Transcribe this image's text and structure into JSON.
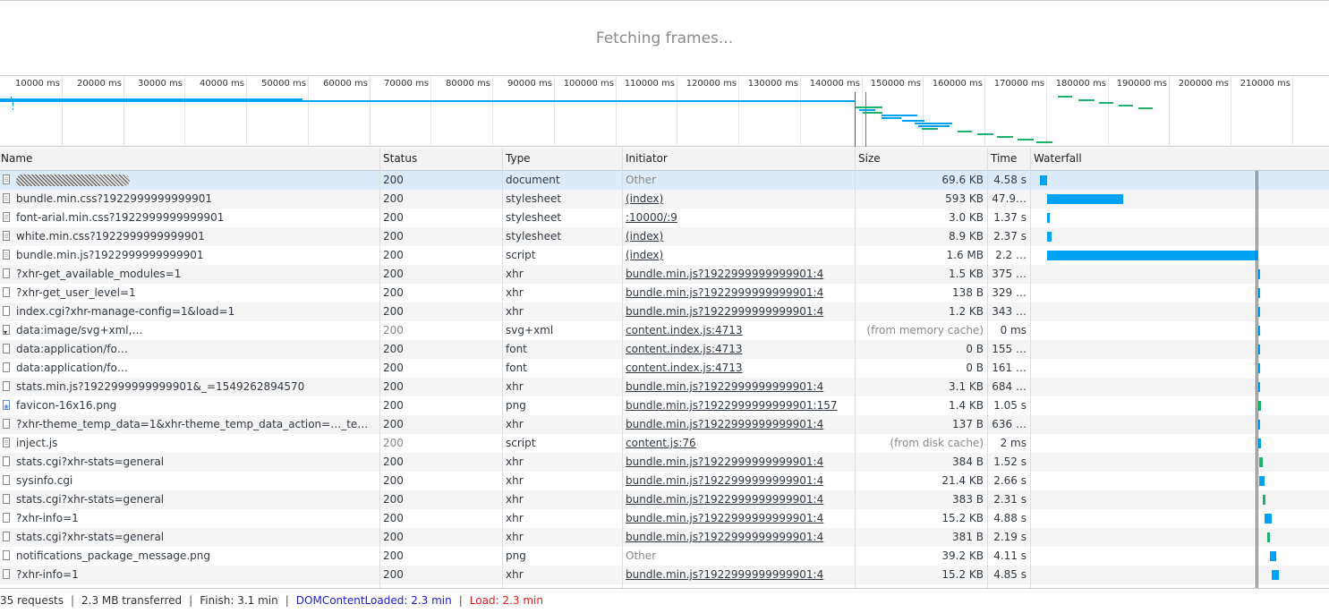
{
  "frames": {
    "message": "Fetching frames..."
  },
  "overview": {
    "max_ms": 216000,
    "ticks": [
      "10000 ms",
      "20000 ms",
      "30000 ms",
      "40000 ms",
      "50000 ms",
      "60000 ms",
      "70000 ms",
      "80000 ms",
      "90000 ms",
      "100000 ms",
      "110000 ms",
      "120000 ms",
      "130000 ms",
      "140000 ms",
      "150000 ms",
      "160000 ms",
      "170000 ms",
      "180000 ms",
      "190000 ms",
      "200000 ms",
      "210000 ms"
    ],
    "dom_content_loaded_ms": 138000,
    "load_ms": 138000
  },
  "columns": {
    "name": "Name",
    "status": "Status",
    "type": "Type",
    "initiator": "Initiator",
    "size": "Size",
    "time": "Time",
    "waterfall": "Waterfall"
  },
  "colors": {
    "bar_blue": "#00a3f3",
    "bar_green": "#1bb36b",
    "dcl_line": "#3b4fd9",
    "load_line": "#e34343",
    "selected_row": "#dcebfa"
  },
  "requests": [
    {
      "name": "",
      "redacted": true,
      "status": "200",
      "type": "document",
      "initiator": "Other",
      "initiator_link": false,
      "size": "69.6 KB",
      "time": "4.58 s",
      "icon": "doc",
      "selected": true,
      "wf_start": 0.002,
      "wf_dur": 0.005,
      "wf_color": "blue"
    },
    {
      "name": "bundle.min.css?1922999999999901",
      "status": "200",
      "type": "stylesheet",
      "initiator": "(index)",
      "initiator_link": true,
      "size": "593 KB",
      "time": "47.9…",
      "icon": "doc",
      "wf_start": 0.007,
      "wf_dur": 0.053,
      "wf_color": "blue"
    },
    {
      "name": "font-arial.min.css?1922999999999901",
      "status": "200",
      "type": "stylesheet",
      "initiator": ":10000/:9",
      "initiator_link": true,
      "size": "3.0 KB",
      "time": "1.37 s",
      "icon": "doc",
      "wf_start": 0.007,
      "wf_dur": 0.002,
      "wf_color": "blue"
    },
    {
      "name": "white.min.css?1922999999999901",
      "status": "200",
      "type": "stylesheet",
      "initiator": "(index)",
      "initiator_link": true,
      "size": "8.9 KB",
      "time": "2.37 s",
      "icon": "doc",
      "wf_start": 0.007,
      "wf_dur": 0.003,
      "wf_color": "blue"
    },
    {
      "name": "bundle.min.js?1922999999999901",
      "status": "200",
      "type": "script",
      "initiator": "(index)",
      "initiator_link": true,
      "size": "1.6 MB",
      "time": "2.2 …",
      "icon": "doc",
      "wf_start": 0.007,
      "wf_dur": 0.147,
      "wf_color": "blue"
    },
    {
      "name": "?xhr-get_available_modules=1",
      "status": "200",
      "type": "xhr",
      "initiator": "bundle.min.js?1922999999999901:4",
      "initiator_link": true,
      "size": "1.5 KB",
      "time": "375 …",
      "icon": "blank",
      "wf_start": 0.1535,
      "wf_dur": 0.0008,
      "wf_color": "blue"
    },
    {
      "name": "?xhr-get_user_level=1",
      "status": "200",
      "type": "xhr",
      "initiator": "bundle.min.js?1922999999999901:4",
      "initiator_link": true,
      "size": "138 B",
      "time": "329 …",
      "icon": "blank",
      "wf_start": 0.1535,
      "wf_dur": 0.0008,
      "wf_color": "blue"
    },
    {
      "name": "index.cgi?xhr-manage-config=1&load=1",
      "status": "200",
      "type": "xhr",
      "initiator": "bundle.min.js?1922999999999901:4",
      "initiator_link": true,
      "size": "1.2 KB",
      "time": "343 …",
      "icon": "blank",
      "wf_start": 0.1535,
      "wf_dur": 0.0008,
      "wf_color": "blue"
    },
    {
      "name": "data:image/svg+xml,…",
      "status": "200",
      "status_gray": true,
      "type": "svg+xml",
      "initiator": "content.index.js:4713",
      "initiator_link": true,
      "size": "(from memory cache)",
      "size_gray": true,
      "time": "0 ms",
      "icon": "svg",
      "wf_start": 0.1535,
      "wf_dur": 0.0006,
      "wf_color": "blue"
    },
    {
      "name": "data:application/fo…",
      "status": "200",
      "type": "font",
      "initiator": "content.index.js:4713",
      "initiator_link": true,
      "size": "0 B",
      "time": "155 …",
      "icon": "blank",
      "wf_start": 0.1535,
      "wf_dur": 0.0006,
      "wf_color": "blue"
    },
    {
      "name": "data:application/fo…",
      "status": "200",
      "type": "font",
      "initiator": "content.index.js:4713",
      "initiator_link": true,
      "size": "0 B",
      "time": "161 …",
      "icon": "blank",
      "wf_start": 0.1535,
      "wf_dur": 0.0006,
      "wf_color": "blue"
    },
    {
      "name": "stats.min.js?1922999999999901&_=1549262894570",
      "status": "200",
      "type": "xhr",
      "initiator": "bundle.min.js?1922999999999901:4",
      "initiator_link": true,
      "size": "3.1 KB",
      "time": "684 …",
      "icon": "blank",
      "wf_start": 0.1535,
      "wf_dur": 0.0012,
      "wf_color": "blue"
    },
    {
      "name": "favicon-16x16.png",
      "status": "200",
      "type": "png",
      "initiator": "bundle.min.js?1922999999999901:157",
      "initiator_link": true,
      "size": "1.4 KB",
      "time": "1.05 s",
      "icon": "img",
      "wf_start": 0.1545,
      "wf_dur": 0.0012,
      "wf_color": "green"
    },
    {
      "name": "?xhr-theme_temp_data=1&xhr-theme_temp_data_action=…_temp_dat…",
      "status": "200",
      "type": "xhr",
      "initiator": "bundle.min.js?1922999999999901:4",
      "initiator_link": true,
      "size": "137 B",
      "time": "636 …",
      "icon": "blank",
      "wf_start": 0.1535,
      "wf_dur": 0.0012,
      "wf_color": "blue"
    },
    {
      "name": "inject.js",
      "status": "200",
      "status_gray": true,
      "type": "script",
      "initiator": "content.js:76",
      "initiator_link": true,
      "size": "(from disk cache)",
      "size_gray": true,
      "time": "2 ms",
      "icon": "doc",
      "wf_start": 0.1545,
      "wf_dur": 0.0004,
      "wf_color": "blue"
    },
    {
      "name": "stats.cgi?xhr-stats=general",
      "status": "200",
      "type": "xhr",
      "initiator": "bundle.min.js?1922999999999901:4",
      "initiator_link": true,
      "size": "384 B",
      "time": "1.52 s",
      "icon": "blank",
      "wf_start": 0.155,
      "wf_dur": 0.0022,
      "wf_color": "green"
    },
    {
      "name": "sysinfo.cgi",
      "status": "200",
      "type": "xhr",
      "initiator": "bundle.min.js?1922999999999901:4",
      "initiator_link": true,
      "size": "21.4 KB",
      "time": "2.66 s",
      "icon": "blank",
      "wf_start": 0.155,
      "wf_dur": 0.0035,
      "wf_color": "blue"
    },
    {
      "name": "stats.cgi?xhr-stats=general",
      "status": "200",
      "type": "xhr",
      "initiator": "bundle.min.js?1922999999999901:4",
      "initiator_link": true,
      "size": "383 B",
      "time": "2.31 s",
      "icon": "blank",
      "wf_start": 0.1575,
      "wf_dur": 0.002,
      "wf_color": "green"
    },
    {
      "name": "?xhr-info=1",
      "status": "200",
      "type": "xhr",
      "initiator": "bundle.min.js?1922999999999901:4",
      "initiator_link": true,
      "size": "15.2 KB",
      "time": "4.88 s",
      "icon": "blank",
      "wf_start": 0.1585,
      "wf_dur": 0.005,
      "wf_color": "blue"
    },
    {
      "name": "stats.cgi?xhr-stats=general",
      "status": "200",
      "type": "xhr",
      "initiator": "bundle.min.js?1922999999999901:4",
      "initiator_link": true,
      "size": "381 B",
      "time": "2.19 s",
      "icon": "blank",
      "wf_start": 0.1605,
      "wf_dur": 0.002,
      "wf_color": "green"
    },
    {
      "name": "notifications_package_message.png",
      "status": "200",
      "type": "png",
      "initiator": "Other",
      "initiator_link": false,
      "size": "39.2 KB",
      "time": "4.11 s",
      "icon": "blank",
      "wf_start": 0.1625,
      "wf_dur": 0.0045,
      "wf_color": "blue"
    },
    {
      "name": "?xhr-info=1",
      "status": "200",
      "type": "xhr",
      "initiator": "bundle.min.js?1922999999999901:4",
      "initiator_link": true,
      "size": "15.2 KB",
      "time": "4.85 s",
      "icon": "blank",
      "wf_start": 0.1635,
      "wf_dur": 0.005,
      "wf_color": "blue"
    }
  ],
  "status_bar": {
    "requests": "35 requests",
    "transferred": "2.3 MB transferred",
    "finish": "Finish: 3.1 min",
    "dom_content_loaded": "DOMContentLoaded: 2.3 min",
    "load": "Load: 2.3 min"
  }
}
